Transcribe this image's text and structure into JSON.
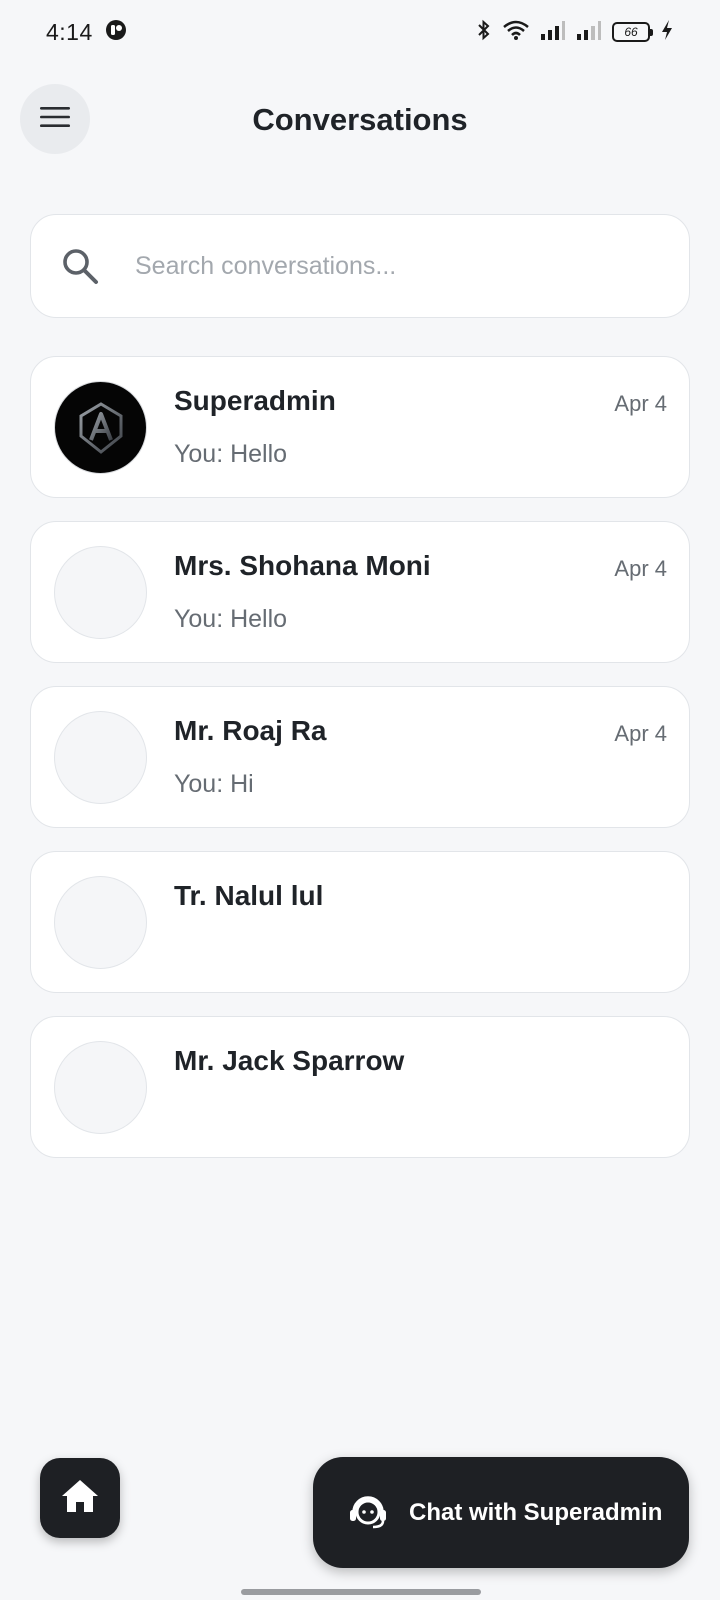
{
  "status_bar": {
    "time": "4:14",
    "battery": "66"
  },
  "header": {
    "title": "Conversations",
    "menu_icon": "hamburger-menu-icon"
  },
  "search": {
    "placeholder": "Search conversations...",
    "value": ""
  },
  "conversations": [
    {
      "name": "Superadmin",
      "date": "Apr 4",
      "preview": "You: Hello",
      "avatar": "logo"
    },
    {
      "name": "Mrs. Shohana Moni",
      "date": "Apr 4",
      "preview": "You: Hello",
      "avatar": "empty"
    },
    {
      "name": "Mr. Roaj Ra",
      "date": "Apr 4",
      "preview": "You: Hi",
      "avatar": "empty"
    },
    {
      "name": "Tr. Nalul lul",
      "date": "",
      "preview": "",
      "avatar": "empty"
    },
    {
      "name": "Mr. Jack Sparrow",
      "date": "",
      "preview": "",
      "avatar": "empty"
    }
  ],
  "bottom": {
    "chat_button_label": "Chat with Superadmin",
    "home_icon": "home-icon",
    "support_icon": "headset-support-icon"
  },
  "colors": {
    "background": "#f6f7f9",
    "card": "#ffffff",
    "dark_button": "#1e2024",
    "muted_text": "#666c73"
  }
}
